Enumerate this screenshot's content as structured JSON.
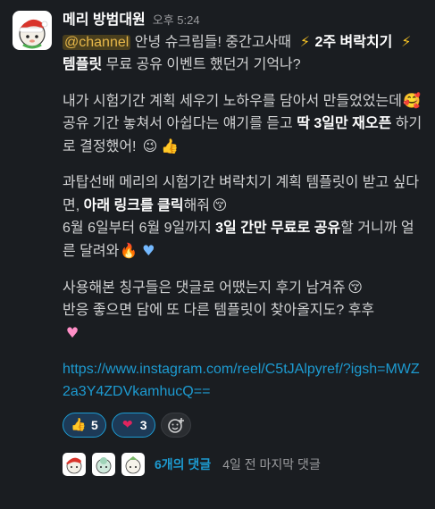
{
  "message": {
    "sender": "메리 방범대원",
    "time": "오후 5:24",
    "mention": "@channel",
    "p1_a": " 안녕 슈크림들! 중간고사때 ",
    "p1_b": "2주 벼락치기",
    "p1_c": "템플릿",
    "p1_d": " 무료 공유 이벤트 했던거 기억나?",
    "p2_a": "내가 시험기간 계획 세우기 노하우를 담아서 만들었었는데",
    "p2_b": "공유 기간 놓쳐서 아쉽다는 얘기를 듣고 ",
    "p2_c": "딱 3일만 재오픈",
    "p2_d": " 하기로 결정했어! ",
    "p3_a": "과탑선배 메리의 시험기간 벼락치기 계획 템플릿이 받고 싶다면, ",
    "p3_b": "아래 링크를 클릭",
    "p3_c": "해줘",
    "p3_d": "6월 6일부터 6월 9일까지 ",
    "p3_e": "3일 간만 무료로 공유",
    "p3_f": "할 거니까 얼른 달려와",
    "p4_a": "사용해본 칭구들은 댓글로 어땠는지 후기 남겨쥬",
    "p4_b": "반응 좋으면 담에 또 다른 템플릿이 찾아올지도? 후후",
    "link": "https://www.instagram.com/reel/C5tJAlpyref/?igsh=MWZ2a3Y4ZDVkamhucQ=="
  },
  "reactions": [
    {
      "emoji": "👍",
      "icon": "thumbs-up-icon",
      "count": "5"
    },
    {
      "emoji": "❤",
      "icon": "heart-icon",
      "count": "3"
    }
  ],
  "thread": {
    "count_label": "6개의 댓글",
    "last_reply": "4일 전 마지막 댓글"
  },
  "colors": {
    "background": "#1a1d21",
    "link": "#1d9bd1",
    "mention_bg": "#4a3f1d",
    "mention_text": "#e8b84a"
  }
}
